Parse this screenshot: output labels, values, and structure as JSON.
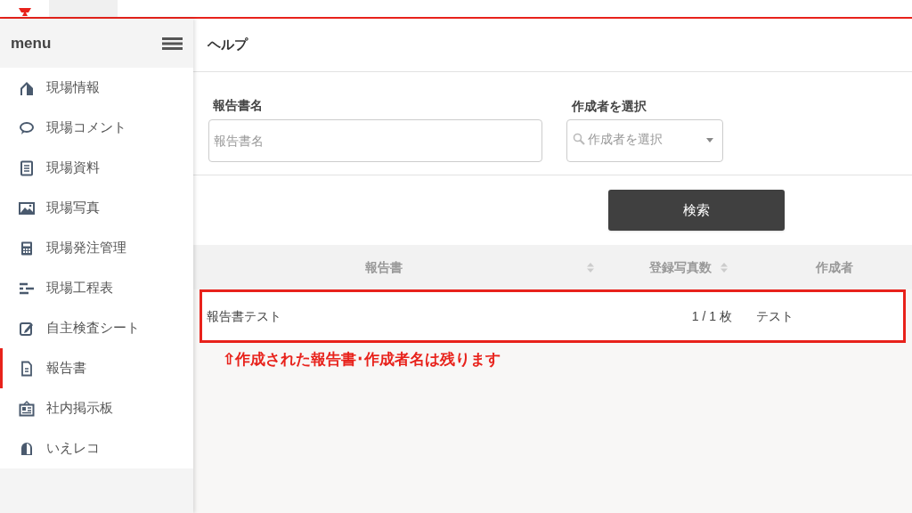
{
  "sidebar": {
    "title": "menu",
    "items": [
      {
        "label": "現場情報",
        "selected": false
      },
      {
        "label": "現場コメント",
        "selected": false
      },
      {
        "label": "現場資料",
        "selected": false
      },
      {
        "label": "現場写真",
        "selected": false
      },
      {
        "label": "現場発注管理",
        "selected": false
      },
      {
        "label": "現場工程表",
        "selected": false
      },
      {
        "label": "自主検査シート",
        "selected": false
      },
      {
        "label": "報告書",
        "selected": true
      },
      {
        "label": "社内掲示板",
        "selected": false
      },
      {
        "label": "いえレコ",
        "selected": false
      }
    ]
  },
  "page": {
    "title": "ヘルプ",
    "name_field": {
      "label": "報告書名",
      "placeholder": "報告書名"
    },
    "author_select": {
      "label": "作成者を選択",
      "placeholder": "作成者を選択"
    },
    "search_button": "検索",
    "table": {
      "columns": [
        {
          "label": "報告書",
          "sortable": true
        },
        {
          "label": "登録写真数",
          "sortable": true
        },
        {
          "label": "作成者",
          "sortable": false
        }
      ],
      "rows": [
        {
          "cells": [
            "報告書テスト",
            "1 / 1 枚",
            "テスト"
          ],
          "highlighted": true
        }
      ]
    },
    "annotation": "⇧作成された報告書･作成者名は残ります"
  }
}
